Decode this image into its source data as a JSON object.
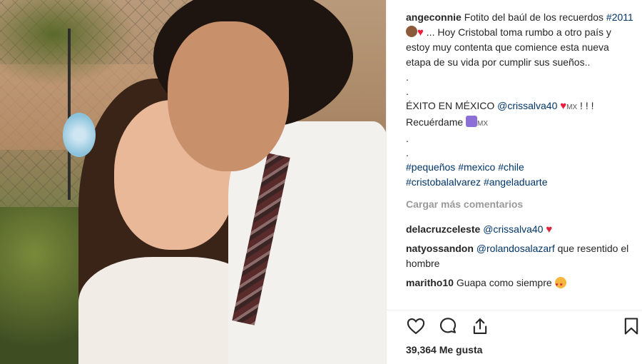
{
  "post": {
    "author": "angeconnie",
    "caption_line1": "Fotito del baúl de los recuerdos",
    "caption_hashtag_year": "#2011",
    "caption_line2": "... Hoy Cristobal toma rumbo a otro país y estoy muy contenta que comience esta nueva etapa de su vida por cumplir sus sueños..",
    "dot1": ".",
    "dot2": ".",
    "exito_text": "ÉXITO EN MÉXICO",
    "exito_mention": "@crissalva40",
    "mx_label": "MX",
    "exclaims": "! ! !",
    "recuerdame": "Recuérdame",
    "mx_label2": "MX",
    "dot3": ".",
    "dot4": ".",
    "hashtags_line1": [
      "#pequeños",
      "#mexico",
      "#chile"
    ],
    "hashtags_line2": [
      "#cristobalalvarez",
      "#angeladuarte"
    ]
  },
  "load_more": "Cargar más comentarios",
  "comments": [
    {
      "user": "delacruzceleste",
      "mention": "@crissalva40",
      "text": ""
    },
    {
      "user": "natyossandon",
      "mention": "@rolandosalazarf",
      "text": "que resentido el hombre"
    },
    {
      "user": "maritho10",
      "mention": "",
      "text": "Guapa como siempre"
    }
  ],
  "actions": {
    "like_icon": "heart-outline-icon",
    "comment_icon": "comment-bubble-icon",
    "share_icon": "share-upload-icon",
    "save_icon": "bookmark-icon"
  },
  "likes_text": "39,364 Me gusta",
  "colors": {
    "link": "#003569",
    "text": "#262626",
    "muted": "#999999",
    "heart": "#ed1c3a"
  }
}
